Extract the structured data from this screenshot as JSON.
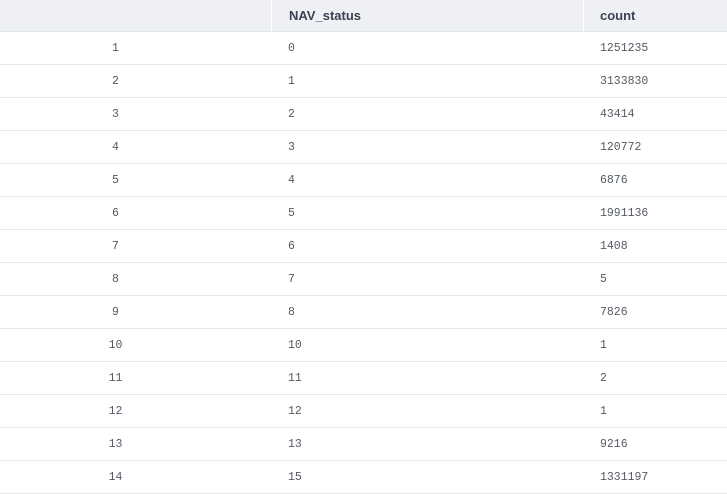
{
  "table": {
    "columns": [
      "",
      "NAV_status",
      "count"
    ],
    "rows": [
      {
        "index": "1",
        "nav_status": "0",
        "count": "1251235"
      },
      {
        "index": "2",
        "nav_status": "1",
        "count": "3133830"
      },
      {
        "index": "3",
        "nav_status": "2",
        "count": "43414"
      },
      {
        "index": "4",
        "nav_status": "3",
        "count": "120772"
      },
      {
        "index": "5",
        "nav_status": "4",
        "count": "6876"
      },
      {
        "index": "6",
        "nav_status": "5",
        "count": "1991136"
      },
      {
        "index": "7",
        "nav_status": "6",
        "count": "1408"
      },
      {
        "index": "8",
        "nav_status": "7",
        "count": "5"
      },
      {
        "index": "9",
        "nav_status": "8",
        "count": "7826"
      },
      {
        "index": "10",
        "nav_status": "10",
        "count": "1"
      },
      {
        "index": "11",
        "nav_status": "11",
        "count": "2"
      },
      {
        "index": "12",
        "nav_status": "12",
        "count": "1"
      },
      {
        "index": "13",
        "nav_status": "13",
        "count": "9216"
      },
      {
        "index": "14",
        "nav_status": "15",
        "count": "1331197"
      }
    ]
  }
}
